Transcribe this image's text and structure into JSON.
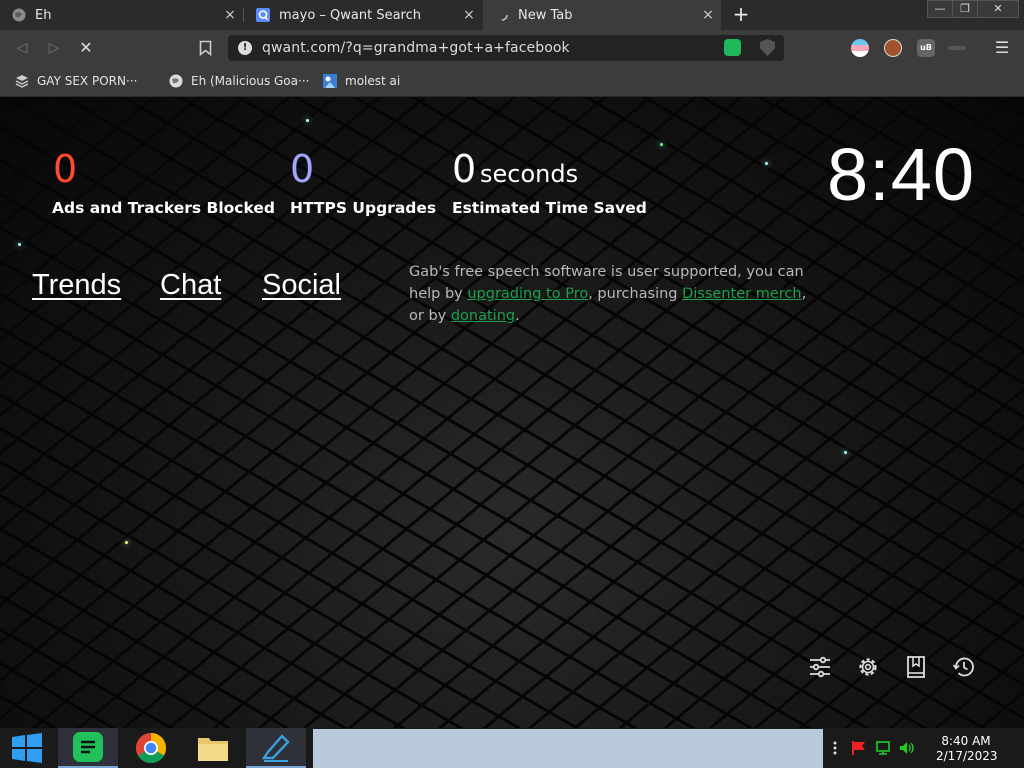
{
  "tabs": [
    {
      "title": "Eh",
      "close": "×",
      "favicon": "globe-icon",
      "active": false
    },
    {
      "title": "mayo – Qwant Search",
      "close": "×",
      "favicon": "qwant-icon",
      "active": false
    },
    {
      "title": "New Tab",
      "close": "×",
      "favicon": "loading-icon",
      "active": true
    }
  ],
  "newtab_symbol": "+",
  "window_controls": {
    "minimize": "—",
    "maximize": "❐",
    "close": "✕"
  },
  "nav": {
    "back": "◁",
    "forward": "▷",
    "stop": "✕",
    "bookmark": "bookmark-icon",
    "url": "qwant.com/?q=grandma+got+a+facebook",
    "menu": "☰"
  },
  "bookmarks": [
    {
      "label": "GAY SEX PORN···",
      "icon": "stack-icon"
    },
    {
      "label": "Eh (Malicious Goa···",
      "icon": "globe-icon"
    },
    {
      "label": "molest ai",
      "icon": "image-icon"
    }
  ],
  "stats": [
    {
      "value": "0",
      "label": "Ads and Trackers Blocked",
      "color": "#ff4a2d"
    },
    {
      "value": "0",
      "label": "HTTPS Upgrades",
      "color": "#a0a5ff"
    },
    {
      "value": "0",
      "label": "Estimated Time Saved",
      "color": "#ffffff"
    }
  ],
  "seconds_unit": "seconds",
  "clock": "8:40",
  "links": {
    "trends": "Trends",
    "chat": "Chat",
    "social": "Social"
  },
  "gab_message": {
    "part1": "Gab's free speech software is user supported, you can help by ",
    "link1": "upgrading to Pro",
    "part2": ", purchasing ",
    "link2": "Dissenter merch",
    "part3": ", or by ",
    "link3": "donating",
    "part4": "."
  },
  "toolbar_icons": [
    "sliders-icon",
    "settings-icon",
    "bookmarks-icon",
    "history-icon"
  ],
  "taskbar": {
    "apps": [
      "windows-start-icon",
      "gab-dissenter-icon",
      "chrome-icon",
      "file-explorer-icon",
      "pen-tool-icon"
    ],
    "time": "8:40 AM",
    "date": "2/17/2023",
    "tray": [
      "more-icon",
      "flag-icon",
      "network-icon",
      "volume-icon"
    ]
  }
}
